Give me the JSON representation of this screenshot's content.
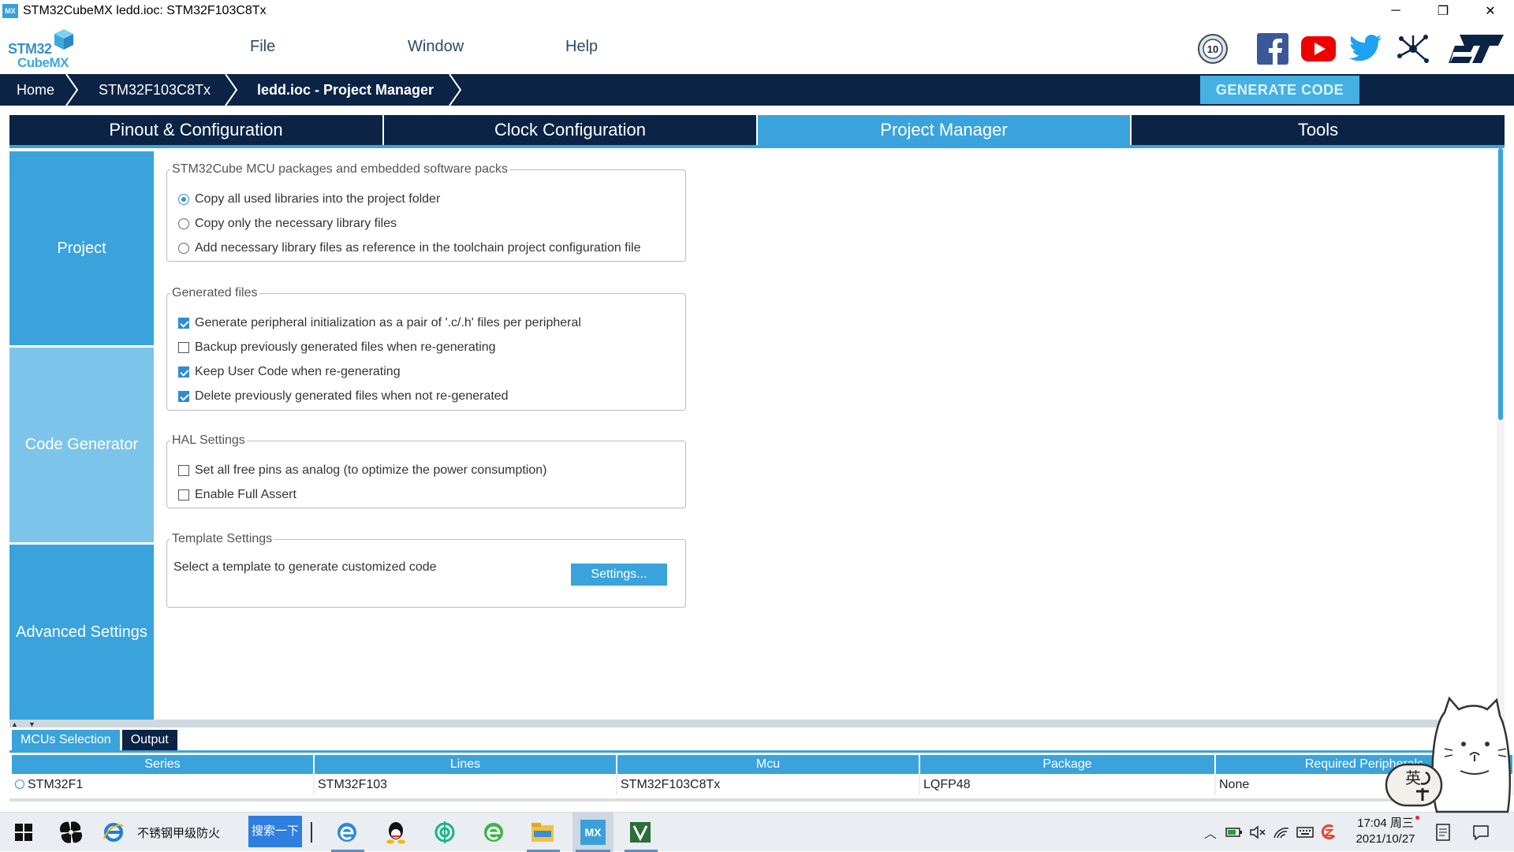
{
  "window": {
    "app_icon": "MX",
    "title": "STM32CubeMX ledd.ioc: STM32F103C8Tx",
    "controls": {
      "minimize": "─",
      "restore": "❐",
      "close": "✕"
    }
  },
  "logo": {
    "line1": "STM32",
    "line2": "CubeMX"
  },
  "menu": {
    "file": "File",
    "window": "Window",
    "help": "Help"
  },
  "social_icons": [
    "anniversary-10-icon",
    "facebook-icon",
    "youtube-icon",
    "twitter-icon",
    "network-share-icon",
    "st-logo-icon"
  ],
  "social": {
    "anniversary": "10"
  },
  "breadcrumb": {
    "home": "Home",
    "mcu": "STM32F103C8Tx",
    "current": "ledd.ioc - Project Manager"
  },
  "generate_button": "GENERATE CODE",
  "tabs": {
    "pinout": "Pinout & Configuration",
    "clock": "Clock Configuration",
    "project_manager": "Project Manager",
    "tools": "Tools",
    "active": "Project Manager"
  },
  "sidebar": {
    "project": "Project",
    "code_generator": "Code Generator",
    "advanced": "Advanced Settings",
    "active": "Code Generator"
  },
  "packages_group": {
    "legend": "STM32Cube MCU packages and embedded software packs",
    "options": [
      {
        "label": "Copy all used libraries into the project folder",
        "selected": true
      },
      {
        "label": "Copy only the necessary library files",
        "selected": false
      },
      {
        "label": "Add necessary library files as reference in the toolchain project configuration file",
        "selected": false
      }
    ]
  },
  "generated_files": {
    "legend": "Generated files",
    "options": [
      {
        "label": "Generate peripheral initialization as a pair of '.c/.h' files per peripheral",
        "checked": true
      },
      {
        "label": "Backup previously generated files when re-generating",
        "checked": false
      },
      {
        "label": "Keep User Code when re-generating",
        "checked": true
      },
      {
        "label": "Delete previously generated files when not re-generated",
        "checked": true
      }
    ]
  },
  "hal_settings": {
    "legend": "HAL Settings",
    "options": [
      {
        "label": "Set all free pins as analog (to optimize the power consumption)",
        "checked": false
      },
      {
        "label": "Enable Full Assert",
        "checked": false
      }
    ]
  },
  "template_settings": {
    "legend": "Template Settings",
    "description": "Select a template to generate customized code",
    "button": "Settings..."
  },
  "bottom_panel": {
    "tabs": {
      "mcus_selection": "MCUs Selection",
      "output": "Output"
    },
    "columns": {
      "series": "Series",
      "lines": "Lines",
      "mcu": "Mcu",
      "package": "Package",
      "required": "Required Peripherals"
    },
    "row": {
      "series": "STM32F1",
      "lines": "STM32F103",
      "mcu": "STM32F103C8Tx",
      "package": "LQFP48",
      "required": "None"
    }
  },
  "taskbar": {
    "ie_label": "不锈钢甲级防火",
    "search_button": "搜索一下",
    "mx_icon": "MX",
    "tray_icons": [
      "chevron-up-icon",
      "battery-icon",
      "volume-mute-icon",
      "wifi-icon",
      "keyboard-icon",
      "sogou-icon"
    ],
    "time": "17:04 周三",
    "date": "2021/10/27"
  },
  "mascot": {
    "ime_label": "英"
  },
  "colors": {
    "navy": "#0b2345",
    "accent": "#3aa3db",
    "sidebar_project": "#3aa3db",
    "sidebar_active": "#7cc4ea"
  }
}
